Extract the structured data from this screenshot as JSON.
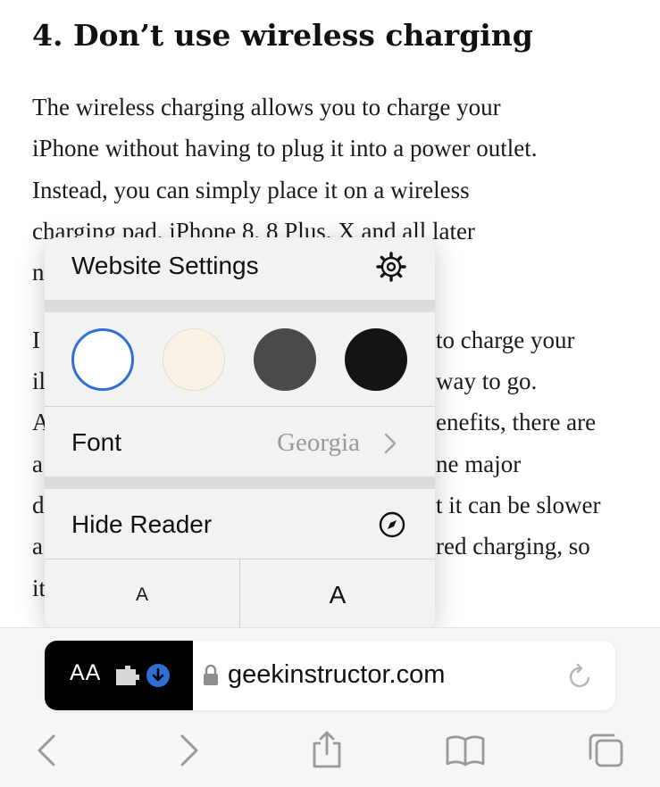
{
  "article": {
    "heading": "4. Don’t use wireless charging",
    "lines": [
      "The wireless charging allows you to charge your",
      "iPhone without having to plug it into a power outlet.",
      "Instead, you can simply place it on a wireless",
      "charging pad. iPhone 8, 8 Plus, X and all later",
      "n",
      "I",
      "il",
      "A",
      "a",
      "d",
      "a",
      "it"
    ],
    "right_lines": [
      "to charge your",
      "way to go.",
      "enefits, there are",
      "ne major",
      "t it can be slower",
      "red charging, so"
    ]
  },
  "popover": {
    "title": "Website Settings",
    "themes": [
      {
        "name": "white",
        "color": "#ffffff",
        "selected": true
      },
      {
        "name": "sepia",
        "color": "#f7f1e6",
        "selected": false
      },
      {
        "name": "gray",
        "color": "#4a4a4c",
        "selected": false
      },
      {
        "name": "black",
        "color": "#141414",
        "selected": false
      }
    ],
    "accent": "#2f6fd6",
    "font_label": "Font",
    "font_value": "Georgia",
    "hide_reader_label": "Hide Reader",
    "font_size_smaller": "A",
    "font_size_larger": "A"
  },
  "toolbar": {
    "reader_button": "AA",
    "url": "geekinstructor.com",
    "icons": [
      "back-icon",
      "forward-icon",
      "share-icon",
      "bookmarks-icon",
      "tabs-icon"
    ]
  }
}
